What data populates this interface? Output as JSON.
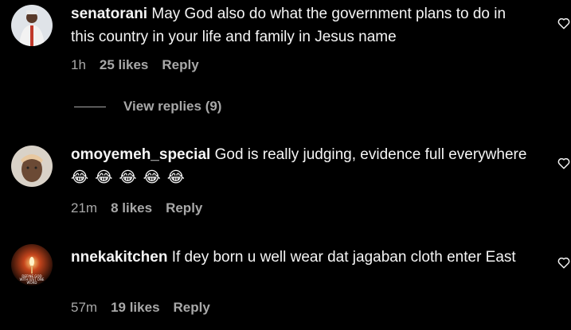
{
  "comments": [
    {
      "username": "senatorani",
      "text": "May God also do what the government plans to do in this country in your life and family in Jesus name",
      "time": "1h",
      "likes": "25 likes",
      "reply": "Reply",
      "view_replies": "View replies (9)"
    },
    {
      "username": "omoyemeh_special",
      "text": "God is really judging, evidence full everywhere",
      "emoji": "😂😂😂😂😂",
      "time": "21m",
      "likes": "8 likes",
      "reply": "Reply"
    },
    {
      "username": "nnekakitchen",
      "text": "If dey born u well wear dat jagaban cloth enter East",
      "avatar_text": "DEFINE GOD WITH JUST ONE WORD",
      "time": "57m",
      "likes": "19 likes",
      "reply": "Reply"
    }
  ],
  "colors": {
    "background": "#000000",
    "text": "#f5f5f5",
    "muted": "#a8a8a8"
  },
  "icons": {
    "like": "heart-outline-icon"
  }
}
